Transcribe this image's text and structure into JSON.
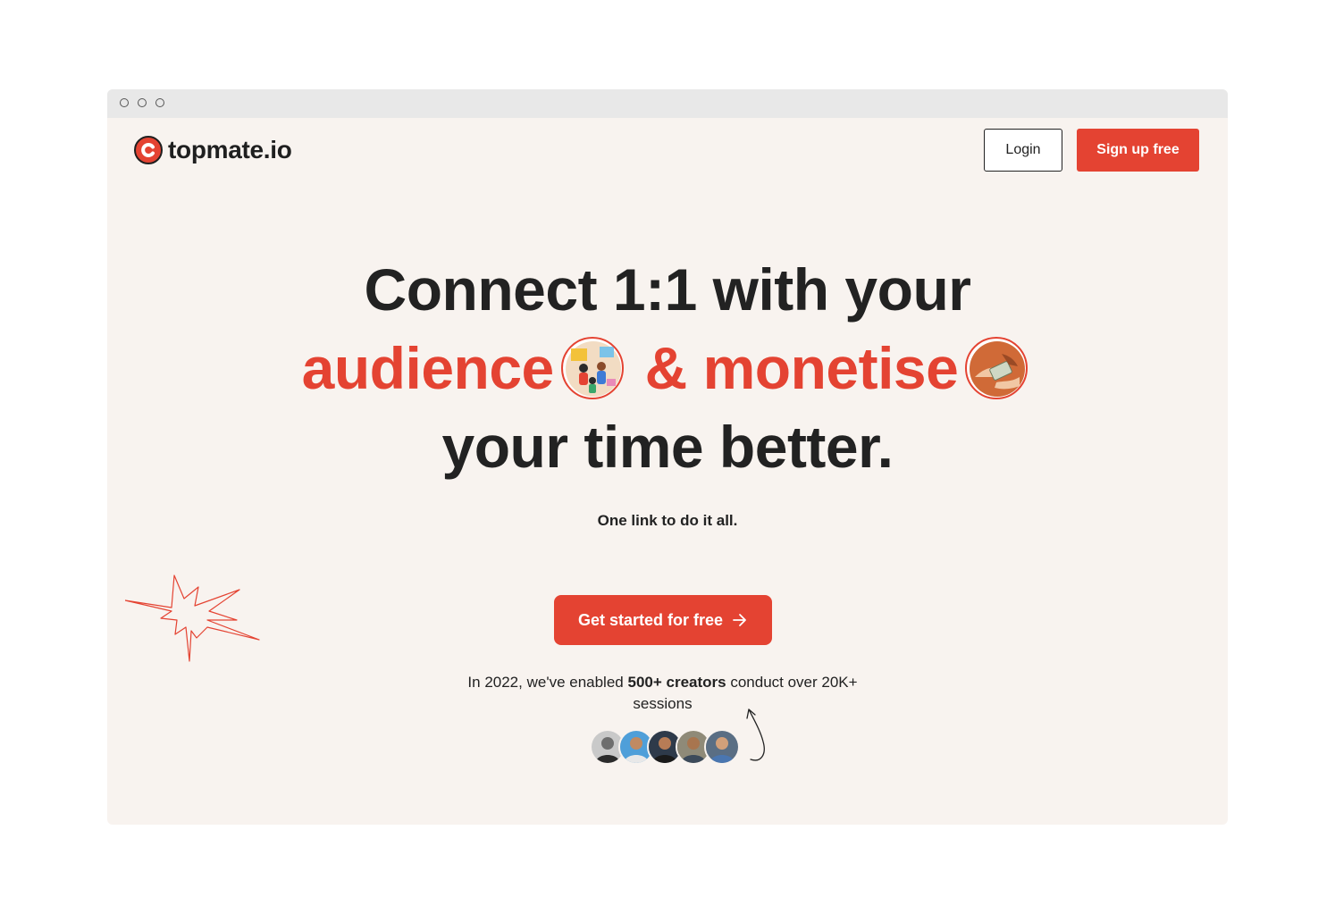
{
  "brand": {
    "name": "topmate.io",
    "color": "#e44332"
  },
  "nav": {
    "login_label": "Login",
    "signup_label": "Sign up free"
  },
  "hero": {
    "line1": "Connect 1:1 with your",
    "line2_part1": "audience",
    "line2_part2": "& monetise",
    "line3": "your time better.",
    "tagline": "One link to do it all."
  },
  "cta": {
    "label": "Get started for free",
    "icon": "arrow-right-icon"
  },
  "stats": {
    "prefix": "In 2022, we've enabled ",
    "highlight": "500+ creators",
    "suffix": " conduct over 20K+ sessions"
  },
  "colors": {
    "accent": "#e44332",
    "background": "#f8f3ef",
    "text": "#222222"
  }
}
